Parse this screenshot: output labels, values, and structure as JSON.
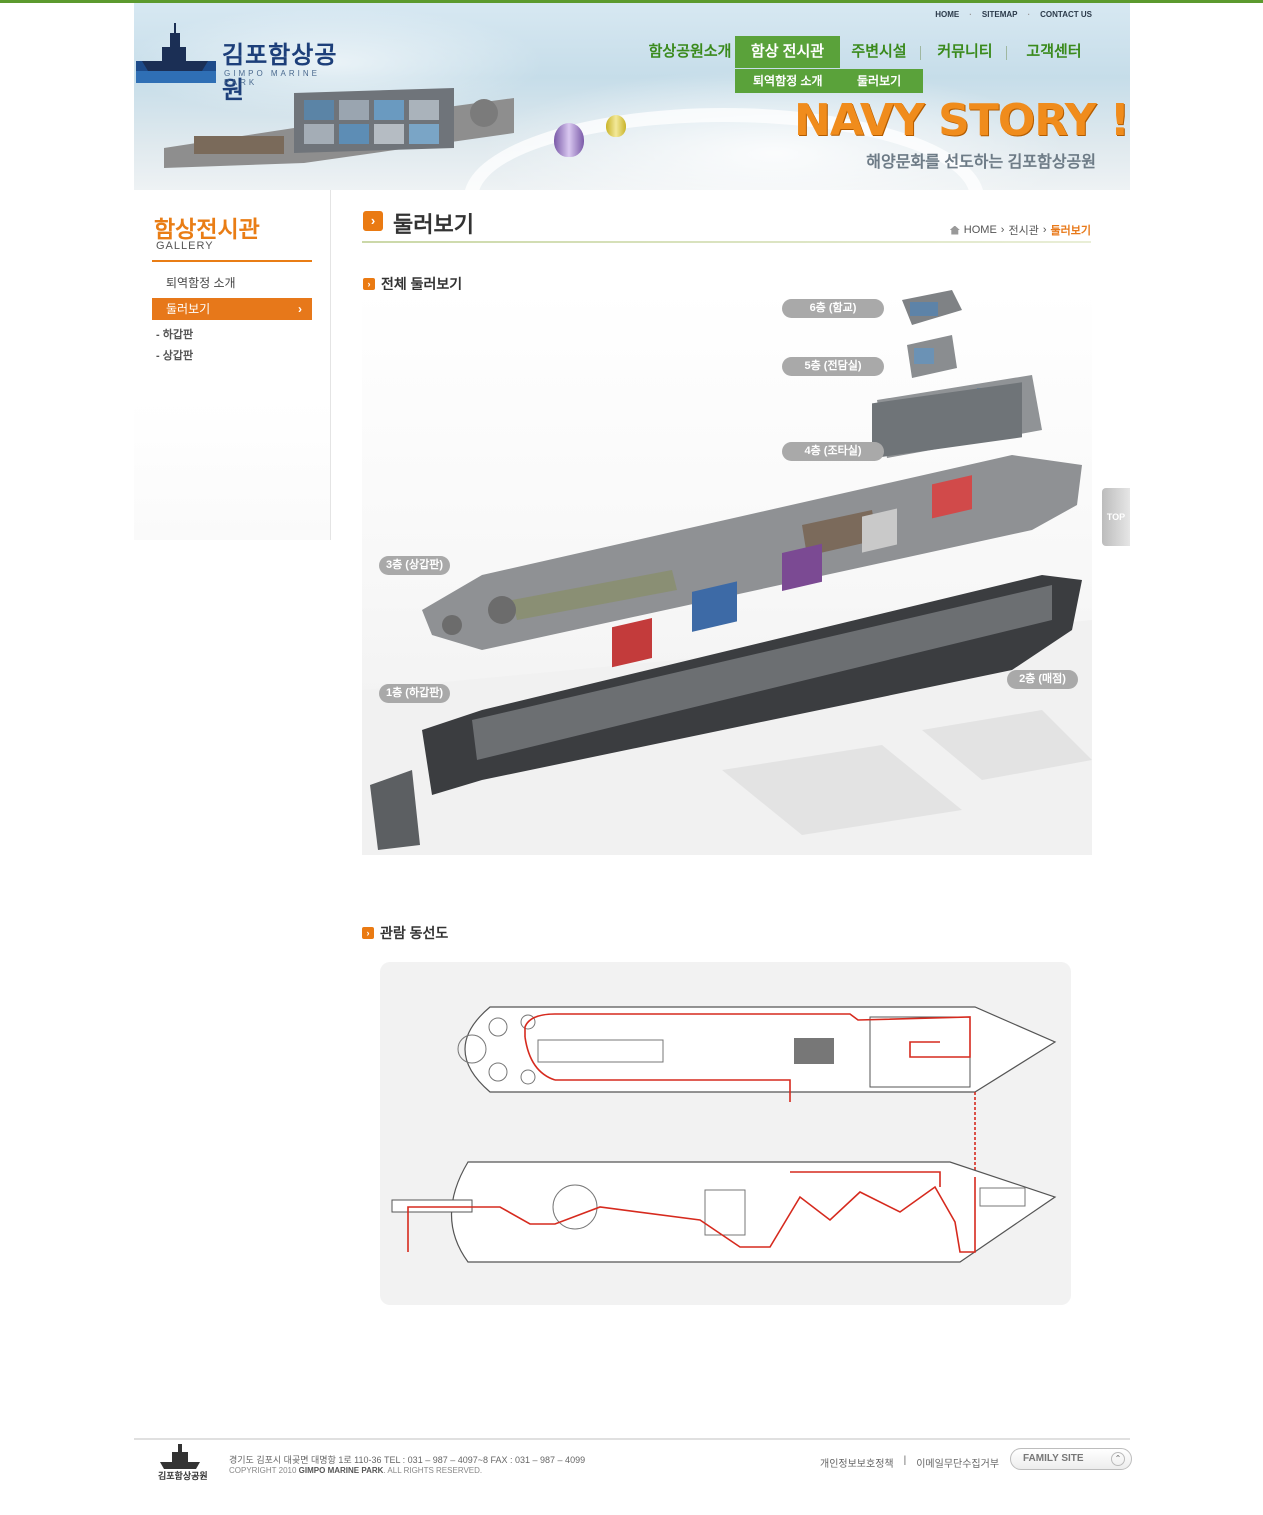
{
  "brand": {
    "logo_text": "김포함상공원",
    "logo_sub": "GIMPO MARINE PARK"
  },
  "utility_nav": [
    "HOME",
    "SITEMAP",
    "CONTACT US"
  ],
  "gnb": {
    "items": [
      "함상공원소개",
      "함상 전시관",
      "주변시설",
      "커뮤니티",
      "고객센터"
    ],
    "active_index": 1,
    "sub_items": [
      "퇴역함정 소개",
      "둘러보기"
    ]
  },
  "hero": {
    "headline": "NAVY STORY !",
    "tagline": "해양문화를 선도하는 김포함상공원"
  },
  "sidebar": {
    "title": "함상전시관",
    "subtitle": "GALLERY",
    "items": [
      "퇴역함정 소개",
      "둘러보기"
    ],
    "active_index": 1,
    "sub_items": [
      "하갑판",
      "상갑판"
    ]
  },
  "page": {
    "title": "둘러보기",
    "breadcrumb": [
      "HOME",
      "전시관",
      "둘러보기"
    ]
  },
  "sections": {
    "overview_title": "전체 둘러보기",
    "route_title": "관람 동선도"
  },
  "deck_labels": [
    "6층 (함교)",
    "5층 (전담실)",
    "4층 (조타실)",
    "3층 (상갑판)",
    "2층 (매점)",
    "1층 (하갑판)"
  ],
  "top_button": "TOP",
  "footer": {
    "address": "경기도 김포시 대곶면 대명항 1로 110-36  TEL : 031 – 987 – 4097~8       FAX : 031 – 987 – 4099",
    "copyright_prefix": "COPYRIGHT 2010",
    "copyright_brand": "GIMPO MARINE PARK",
    "copyright_suffix": ". ALL RIGHTS RESERVED.",
    "links": [
      "개인정보보호정책",
      "이메일무단수집거부"
    ],
    "family_site": "FAMILY SITE",
    "logo_text": "김포함상공원"
  },
  "colors": {
    "accent_orange": "#e97d15",
    "accent_green": "#5aa23a",
    "route_red": "#d62a1e"
  }
}
